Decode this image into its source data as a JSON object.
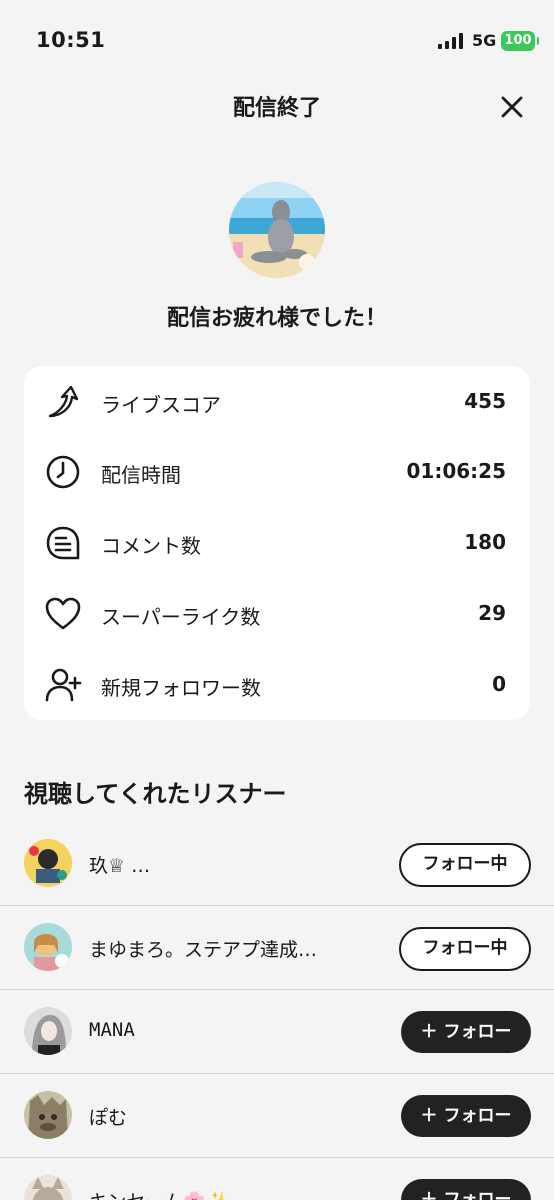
{
  "status_bar": {
    "time": "10:51",
    "network": "5G",
    "battery": "100"
  },
  "header": {
    "title": "配信終了"
  },
  "host": {
    "message": "配信お疲れ様でした！"
  },
  "stats": [
    {
      "icon": "arrow-score-icon",
      "label": "ライブスコア",
      "value": "455"
    },
    {
      "icon": "clock-icon",
      "label": "配信時間",
      "value": "01:06:25"
    },
    {
      "icon": "comment-icon",
      "label": "コメント数",
      "value": "180"
    },
    {
      "icon": "heart-icon",
      "label": "スーパーライク数",
      "value": "29"
    },
    {
      "icon": "add-user-icon",
      "label": "新規フォロワー数",
      "value": "0"
    }
  ],
  "listeners_section": {
    "title": "視聴してくれたリスナー"
  },
  "listeners": [
    {
      "name": "玖♕ …",
      "button_label": "フォロー中",
      "following": true
    },
    {
      "name": "まゆまろ。ステアプ達成…",
      "button_label": "フォロー中",
      "following": true
    },
    {
      "name": "MANA",
      "button_label": "フォロー",
      "following": false
    },
    {
      "name": "ぽむ",
      "button_label": "フォロー",
      "following": false
    },
    {
      "name": "キンセーム🌸✨",
      "button_label": "フォロー",
      "following": false
    }
  ],
  "colors": {
    "background": "#f4f4f4",
    "card": "#ffffff",
    "dark_button": "#222222",
    "battery": "#3cc85a"
  }
}
